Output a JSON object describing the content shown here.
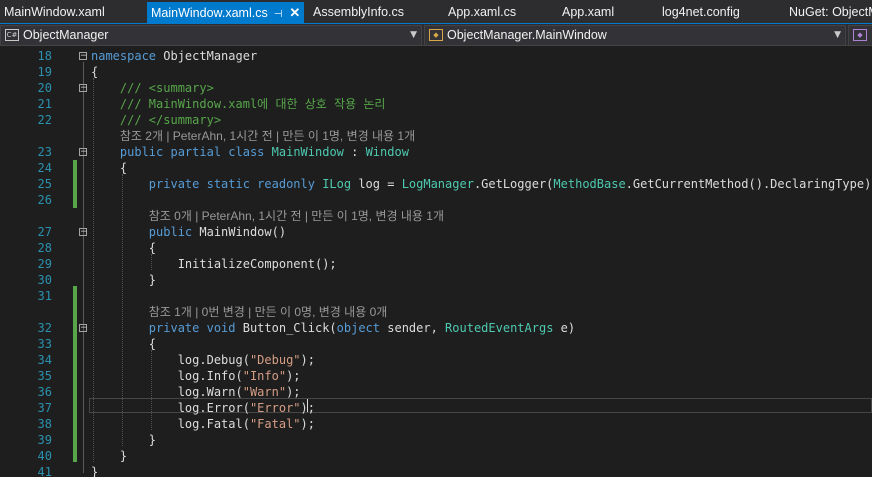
{
  "tabs": [
    {
      "label": "MainWindow.xaml",
      "active": false
    },
    {
      "label": "MainWindow.xaml.cs",
      "active": true,
      "pin_icon": "pin-icon",
      "close_icon": "close-icon"
    },
    {
      "label": "AssemblyInfo.cs",
      "active": false
    },
    {
      "label": "App.xaml.cs",
      "active": false
    },
    {
      "label": "App.xaml",
      "active": false
    },
    {
      "label": "log4net.config",
      "active": false
    },
    {
      "label": "NuGet: ObjectM",
      "active": false
    }
  ],
  "navbar": {
    "project": "ObjectManager",
    "type": "ObjectManager.MainWindow",
    "member_icon": "method-icon"
  },
  "colors": {
    "accent": "#007acc",
    "keyword": "#569cd6",
    "type": "#4ec9b0",
    "comment": "#57a64a",
    "string": "#d69d85",
    "line_number": "#2b91af",
    "changed_line": "#57a64a"
  },
  "editor": {
    "lines": [
      {
        "n": "18",
        "tokens": [
          [
            "kw",
            "namespace"
          ],
          [
            "tx",
            " ObjectManager"
          ]
        ]
      },
      {
        "n": "19",
        "tokens": [
          [
            "tx",
            "{"
          ]
        ]
      },
      {
        "n": "20",
        "tokens": [
          [
            "tx",
            "    "
          ],
          [
            "cm",
            "/// <summary>"
          ]
        ]
      },
      {
        "n": "21",
        "tokens": [
          [
            "tx",
            "    "
          ],
          [
            "cm",
            "/// MainWindow.xaml에 대한 상호 작용 논리"
          ]
        ]
      },
      {
        "n": "22",
        "tokens": [
          [
            "tx",
            "    "
          ],
          [
            "cm",
            "/// </summary>"
          ]
        ]
      },
      {
        "lens": "참조 2개 | PeterAhn, 1시간 전 | 만든 이 1명, 변경 내용 1개",
        "indent": 4
      },
      {
        "n": "23",
        "tokens": [
          [
            "tx",
            "    "
          ],
          [
            "kw",
            "public partial class"
          ],
          [
            "tx",
            " "
          ],
          [
            "ty",
            "MainWindow"
          ],
          [
            "tx",
            " : "
          ],
          [
            "ty",
            "Window"
          ]
        ]
      },
      {
        "n": "24",
        "tokens": [
          [
            "tx",
            "    {"
          ]
        ]
      },
      {
        "n": "25",
        "tokens": [
          [
            "tx",
            "        "
          ],
          [
            "kw",
            "private static readonly"
          ],
          [
            "tx",
            " "
          ],
          [
            "ty",
            "ILog"
          ],
          [
            "tx",
            " log = "
          ],
          [
            "ty",
            "LogManager"
          ],
          [
            "tx",
            ".GetLogger("
          ],
          [
            "ty",
            "MethodBase"
          ],
          [
            "tx",
            ".GetCurrentMethod().DeclaringType);"
          ]
        ]
      },
      {
        "n": "26",
        "tokens": []
      },
      {
        "lens": "참조 0개 | PeterAhn, 1시간 전 | 만든 이 1명, 변경 내용 1개",
        "indent": 8
      },
      {
        "n": "27",
        "tokens": [
          [
            "tx",
            "        "
          ],
          [
            "kw",
            "public"
          ],
          [
            "tx",
            " MainWindow()"
          ]
        ]
      },
      {
        "n": "28",
        "tokens": [
          [
            "tx",
            "        {"
          ]
        ]
      },
      {
        "n": "29",
        "tokens": [
          [
            "tx",
            "            InitializeComponent();"
          ]
        ]
      },
      {
        "n": "30",
        "tokens": [
          [
            "tx",
            "        }"
          ]
        ]
      },
      {
        "n": "31",
        "tokens": []
      },
      {
        "lens": "참조 1개 | 0번 변경 | 만든 이 0명, 변경 내용 0개",
        "indent": 8
      },
      {
        "n": "32",
        "tokens": [
          [
            "tx",
            "        "
          ],
          [
            "kw",
            "private void"
          ],
          [
            "tx",
            " Button_Click("
          ],
          [
            "kw",
            "object"
          ],
          [
            "tx",
            " sender, "
          ],
          [
            "ty",
            "RoutedEventArgs"
          ],
          [
            "tx",
            " e)"
          ]
        ]
      },
      {
        "n": "33",
        "tokens": [
          [
            "tx",
            "        {"
          ]
        ]
      },
      {
        "n": "34",
        "tokens": [
          [
            "tx",
            "            log.Debug("
          ],
          [
            "st",
            "\"Debug\""
          ],
          [
            "tx",
            ");"
          ]
        ]
      },
      {
        "n": "35",
        "tokens": [
          [
            "tx",
            "            log.Info("
          ],
          [
            "st",
            "\"Info\""
          ],
          [
            "tx",
            ");"
          ]
        ]
      },
      {
        "n": "36",
        "tokens": [
          [
            "tx",
            "            log.Warn("
          ],
          [
            "st",
            "\"Warn\""
          ],
          [
            "tx",
            ");"
          ]
        ]
      },
      {
        "n": "37",
        "tokens": [
          [
            "tx",
            "            log.Error("
          ],
          [
            "st",
            "\"Error\""
          ],
          [
            "tx",
            ");"
          ]
        ]
      },
      {
        "n": "38",
        "tokens": [
          [
            "tx",
            "            log.Fatal("
          ],
          [
            "st",
            "\"Fatal\""
          ],
          [
            "tx",
            ");"
          ]
        ]
      },
      {
        "n": "39",
        "tokens": [
          [
            "tx",
            "        }"
          ]
        ]
      },
      {
        "n": "40",
        "tokens": [
          [
            "tx",
            "    }"
          ]
        ]
      },
      {
        "n": "41",
        "tokens": [
          [
            "tx",
            "}"
          ]
        ]
      }
    ]
  }
}
